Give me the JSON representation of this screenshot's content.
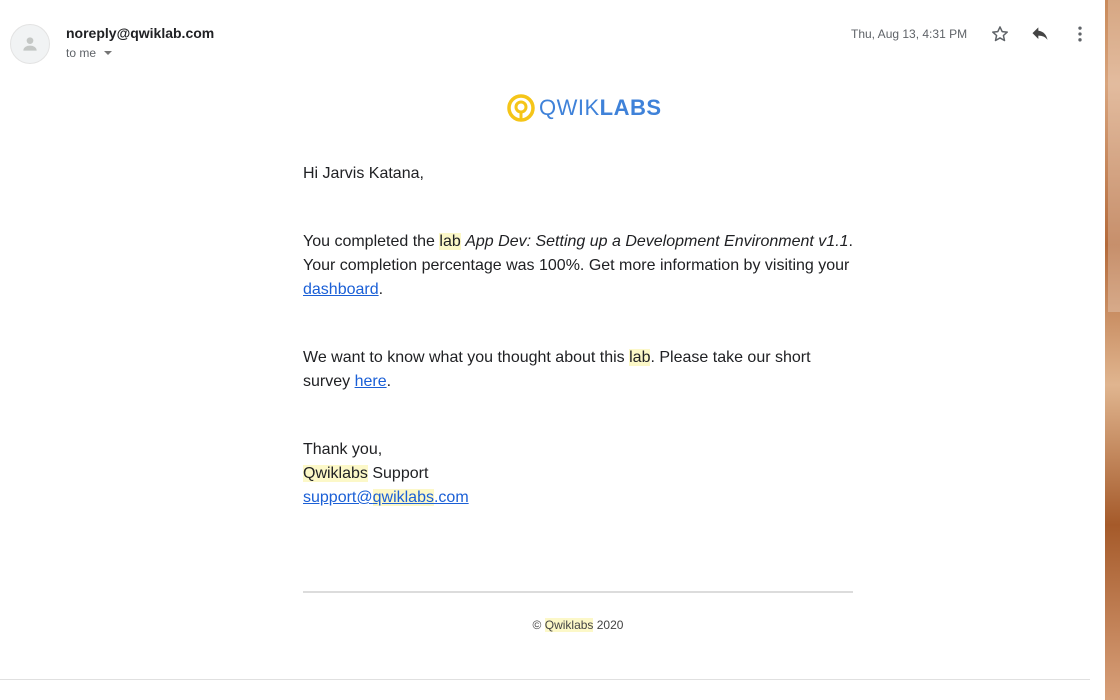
{
  "header": {
    "sender": "noreply@qwiklab.com",
    "recipient_label": "to me",
    "timestamp": "Thu, Aug 13, 4:31 PM",
    "icons": [
      "person-avatar-icon",
      "star-icon",
      "reply-icon",
      "more-vert-icon"
    ]
  },
  "logo": {
    "text_light": "QWIK",
    "text_bold": "LABS",
    "brand_yellow": "#f5c518",
    "brand_blue": "#3f82d9"
  },
  "message": {
    "greeting": "Hi Jarvis Katana,",
    "p1_before": "You completed the ",
    "p1_hl": "lab",
    "p1_space": " ",
    "p1_lab_title": "App Dev: Setting up a Development Environment v1.1",
    "p1_after": ". Your completion percentage was 100%. Get more information by visiting your ",
    "p1_link": "dashboard",
    "p1_end": ".",
    "p2_before": "We want to know what you thought about this ",
    "p2_hl": "lab",
    "p2_after": ". Please take our short survey ",
    "p2_link": "here",
    "p2_end": ".",
    "signoff": "Thank you,",
    "sig_hl": "Qwiklabs",
    "sig_rest": " Support",
    "email_a": "support@",
    "email_hl": "qwiklabs",
    "email_b": ".com"
  },
  "footer": {
    "copy_symbol": "© ",
    "company": "Qwiklabs",
    "year": " 2020"
  },
  "colors": {
    "link": "#1a5fd6",
    "highlight": "#fcf8c8"
  }
}
